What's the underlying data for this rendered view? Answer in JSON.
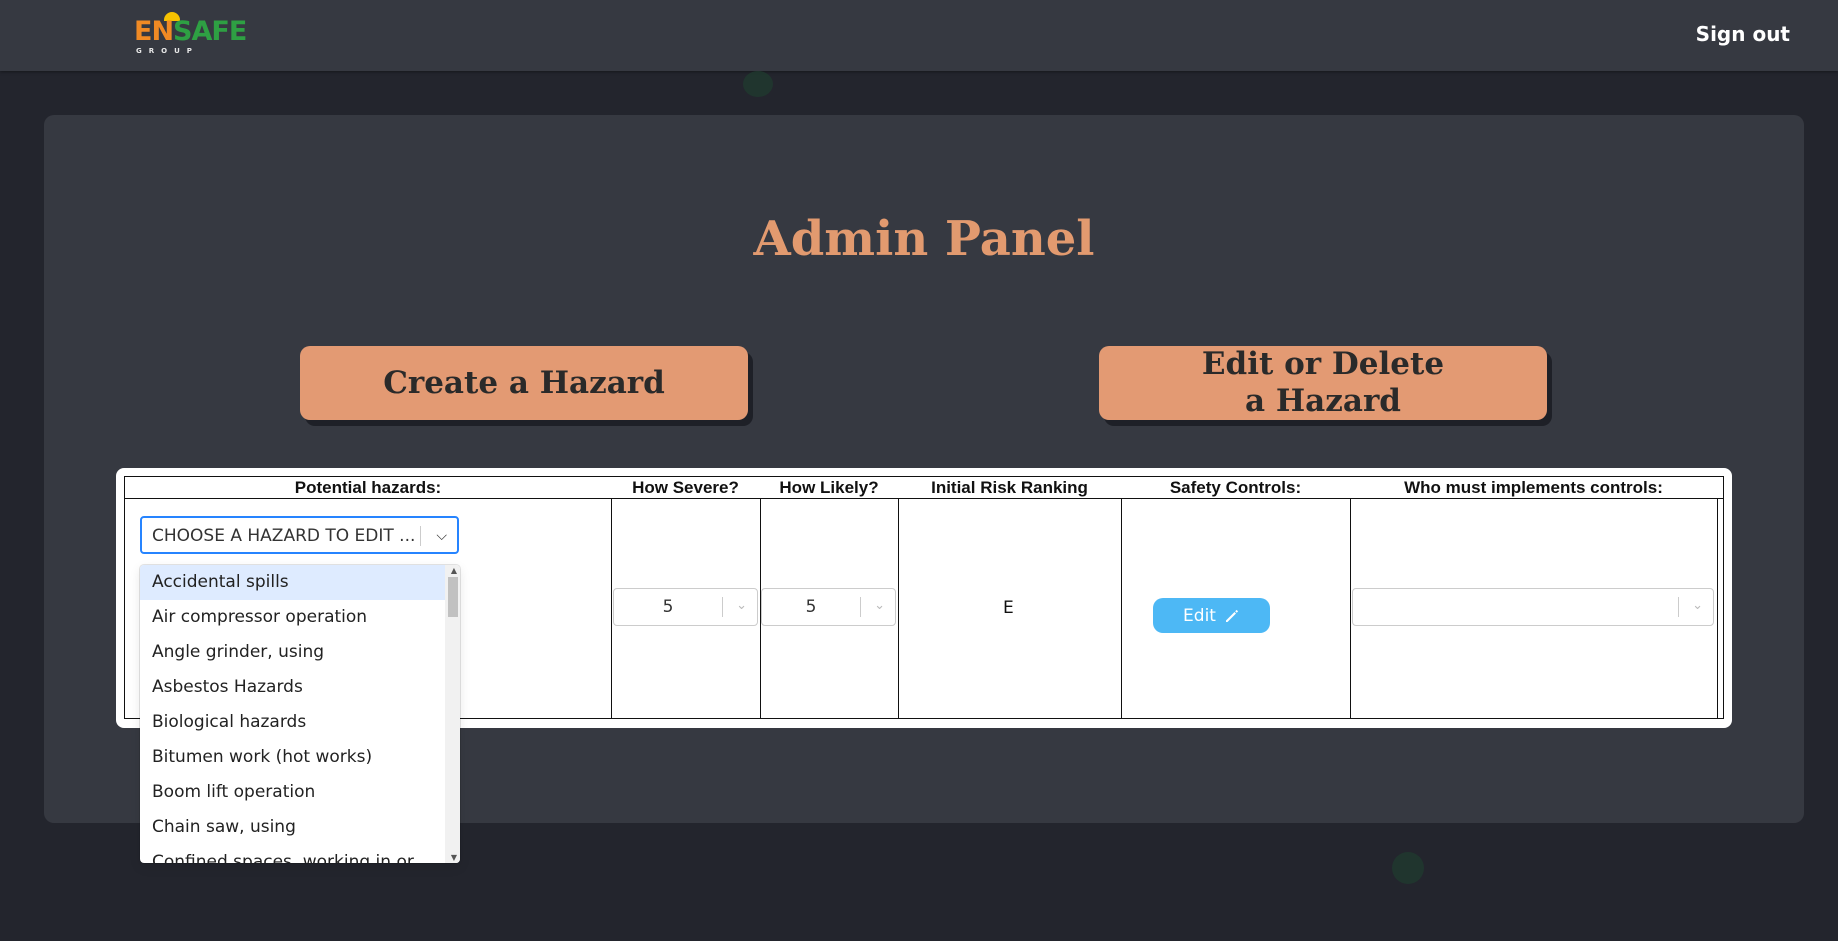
{
  "brand": {
    "logo_en": "EN",
    "logo_safe": "SAFE",
    "logo_group": "GROUP",
    "colors": {
      "en": "#f08a24",
      "safe": "#2ea043",
      "accent": "#e39a73",
      "edit": "#4db8f5"
    }
  },
  "header": {
    "signout_label": "Sign out"
  },
  "panel": {
    "title": "Admin Panel",
    "create_label": "Create a Hazard",
    "edit_delete_label": "Edit or Delete a Hazard"
  },
  "table": {
    "columns": [
      "Potential hazards:",
      "How Severe?",
      "How Likely?",
      "Initial Risk Ranking",
      "Safety Controls:",
      "Who must implements controls:"
    ],
    "hazard_placeholder": "CHOOSE A HAZARD TO EDIT ...",
    "severity_value": "5",
    "likelihood_value": "5",
    "risk_ranking": "E",
    "edit_label": "Edit",
    "who_value": ""
  },
  "dropdown": {
    "options": [
      "Accidental spills",
      "Air compressor operation",
      "Angle grinder, using",
      "Asbestos Hazards",
      "Biological hazards",
      "Bitumen work (hot works)",
      "Boom lift operation",
      "Chain saw, using",
      "Confined spaces, working in or..."
    ],
    "highlighted": "Accidental spills"
  }
}
